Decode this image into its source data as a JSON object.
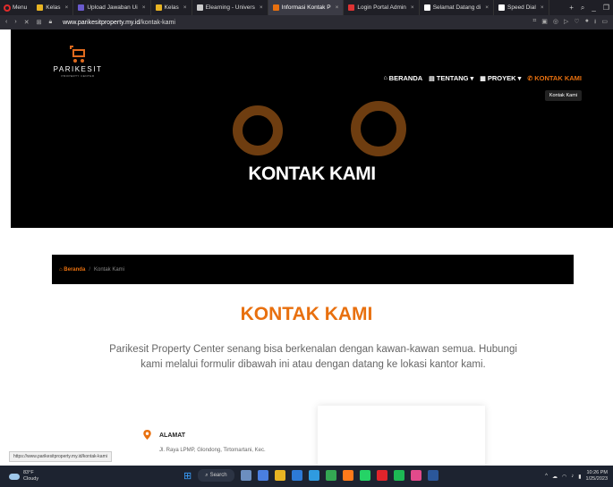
{
  "browser": {
    "menu_label": "Menu",
    "tabs": [
      {
        "title": "Kelas",
        "color": "#e8b423",
        "active": false
      },
      {
        "title": "Upload Jawaban Ui",
        "color": "#6a5acd",
        "active": false
      },
      {
        "title": "Kelas",
        "color": "#e8b423",
        "active": false
      },
      {
        "title": "Elearning - Univers",
        "color": "#cccccc",
        "active": false
      },
      {
        "title": "Informasi Kontak P",
        "color": "#e8700f",
        "active": true
      },
      {
        "title": "Login Portal Admin",
        "color": "#d33",
        "active": false
      },
      {
        "title": "Selamat Datang di",
        "color": "#ffffff",
        "active": false
      },
      {
        "title": "Speed Dial",
        "color": "#ffffff",
        "active": false
      }
    ],
    "url_domain": "www.parikesitproperty.my.id",
    "url_path": "/kontak-kami"
  },
  "site": {
    "logo_name": "PARIKESIT",
    "logo_sub": "PROPERTY CENTER",
    "nav": [
      {
        "label": "BERANDA",
        "icon": "home-icon",
        "active": false,
        "dropdown": false
      },
      {
        "label": "TENTANG",
        "icon": "building-icon",
        "active": false,
        "dropdown": true
      },
      {
        "label": "PROYEK",
        "icon": "project-icon",
        "active": false,
        "dropdown": true
      },
      {
        "label": "KONTAK KAMI",
        "icon": "phone-icon",
        "active": true,
        "dropdown": false
      }
    ],
    "tooltip": "Kontak Kami",
    "hero_title": "KONTAK KAMI",
    "breadcrumb": {
      "home": "Beranda",
      "current": "Kontak Kami"
    },
    "section_title": "KONTAK KAMI",
    "intro": "Parikesit Property Center senang bisa berkenalan dengan kawan-kawan semua. Hubungi kami melalui formulir dibawah ini atau dengan datang ke lokasi kantor kami.",
    "address_label": "ALAMAT",
    "address_text": "Jl. Raya LPMP, Glondong, Tirtomartani, Kec."
  },
  "status_url": "https://www.parikesitproperty.my.id/kontak-kami",
  "taskbar": {
    "temp": "83°F",
    "weather": "Cloudy",
    "search_label": "Search",
    "time": "10:26 PM",
    "date": "1/25/2023"
  },
  "colors": {
    "accent": "#e8700f",
    "hero_bg": "#000000"
  }
}
